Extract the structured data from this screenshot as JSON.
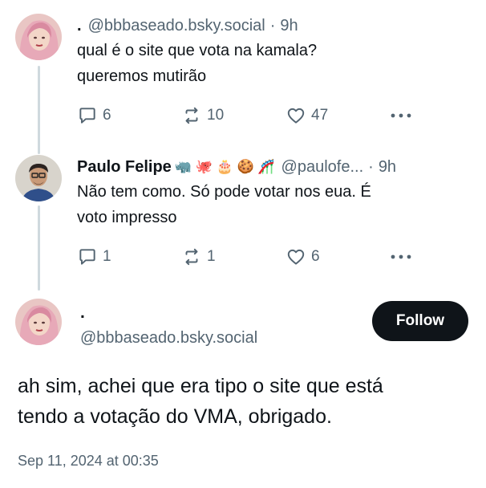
{
  "reply1": {
    "name": ".",
    "handle": "@bbbaseado.bsky.social",
    "separator": "·",
    "time": "9h",
    "text_line1": "qual é o site que vota na kamala?",
    "text_line2": "queremos mutirão",
    "replies": "6",
    "reposts": "10",
    "likes": "47"
  },
  "reply2": {
    "name": "Paulo Felipe",
    "emojis": "🦏 🐙 🎂 🍪 🎢",
    "handle": "@paulofe...",
    "separator": "·",
    "time": "9h",
    "text_line1": "Não tem como. Só pode votar nos eua. É",
    "text_line2": "voto impresso",
    "replies": "1",
    "reposts": "1",
    "likes": "6"
  },
  "main_post": {
    "name": ".",
    "handle": "@bbbaseado.bsky.social",
    "follow_label": "Follow",
    "text_line1": "ah sim, achei que era tipo o site que está",
    "text_line2": "tendo a votação do VMA, obrigado.",
    "timestamp": "Sep 11, 2024 at 00:35"
  },
  "icons": {
    "reply": "speech-bubble-icon",
    "repost": "repost-arrows-icon",
    "like": "heart-icon",
    "more": "more-dots-icon"
  },
  "colors": {
    "text": "#0f1419",
    "muted": "#536471",
    "thread_line": "#cfd9de",
    "follow_bg": "#0f1419"
  }
}
